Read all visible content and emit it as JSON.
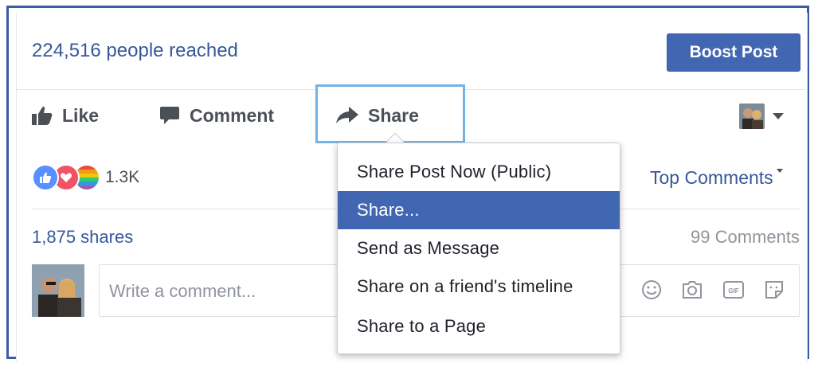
{
  "post": {
    "reach_text": "224,516 people reached",
    "boost_label": "Boost Post"
  },
  "actions": {
    "like": "Like",
    "comment": "Comment",
    "share": "Share"
  },
  "reactions": {
    "count": "1.3K",
    "icons": [
      "like-icon",
      "love-icon",
      "pride-icon"
    ]
  },
  "sort": {
    "label": "Top Comments"
  },
  "stats": {
    "shares": "1,875 shares",
    "comments": "99 Comments"
  },
  "composer": {
    "placeholder": "Write a comment...",
    "icons": [
      "emoji-icon",
      "camera-icon",
      "gif-icon",
      "sticker-icon"
    ]
  },
  "share_menu": {
    "items": [
      {
        "label": "Share Post Now (Public)",
        "active": false
      },
      {
        "label": "Share...",
        "active": true
      },
      {
        "label": "Send as Message",
        "active": false
      },
      {
        "label": "Share on a friend's timeline",
        "active": false
      },
      {
        "label": "Share to a Page",
        "active": false
      }
    ]
  },
  "colors": {
    "brand_blue": "#4267b2",
    "link_blue": "#365899",
    "focus_outline": "#74b3e6",
    "frame_border": "#3b5ca5",
    "text_gray": "#4b4f56"
  }
}
